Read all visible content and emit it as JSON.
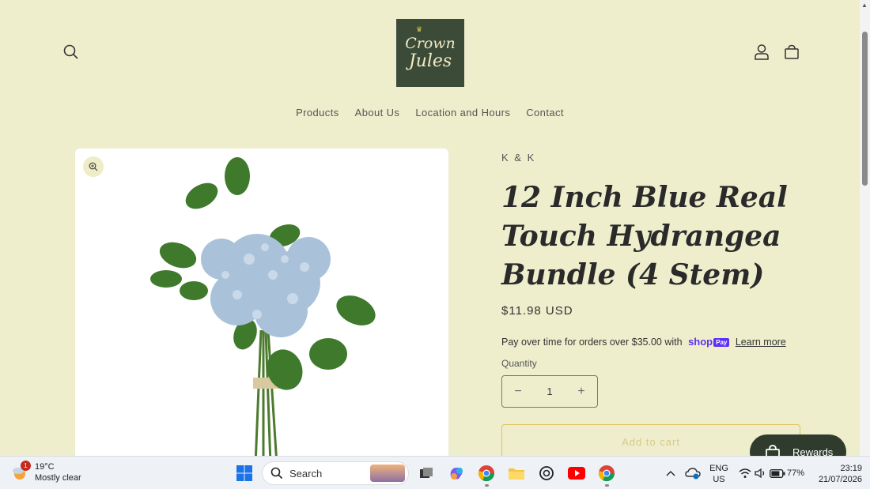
{
  "header": {
    "logo_line1": "Crown",
    "logo_line2": "Jules",
    "nav": [
      "Products",
      "About Us",
      "Location and Hours",
      "Contact"
    ]
  },
  "product": {
    "vendor": "K & K",
    "title": "12 Inch Blue Real Touch Hydrangea Bundle (4 Stem)",
    "price": "$11.98 USD",
    "installments_text": "Pay over time for orders over $35.00 with",
    "shop_logo": "shop",
    "shop_pay": "Pay",
    "learn_more": "Learn more",
    "quantity_label": "Quantity",
    "quantity_value": "1",
    "add_to_cart": "Add to cart"
  },
  "rewards": {
    "label": "Rewards"
  },
  "taskbar": {
    "weather_temp": "19°C",
    "weather_desc": "Mostly clear",
    "notification_count": "1",
    "search_label": "Search",
    "lang_line1": "ENG",
    "lang_line2": "US",
    "battery": "77%",
    "time": "23:19",
    "date": "21/07/2026"
  },
  "colors": {
    "page_bg": "#eeeecd",
    "logo_bg": "#3c4a38",
    "accent_border": "#ddc458",
    "rewards_bg": "#2f3b2d",
    "shop_purple": "#5a31f4"
  }
}
